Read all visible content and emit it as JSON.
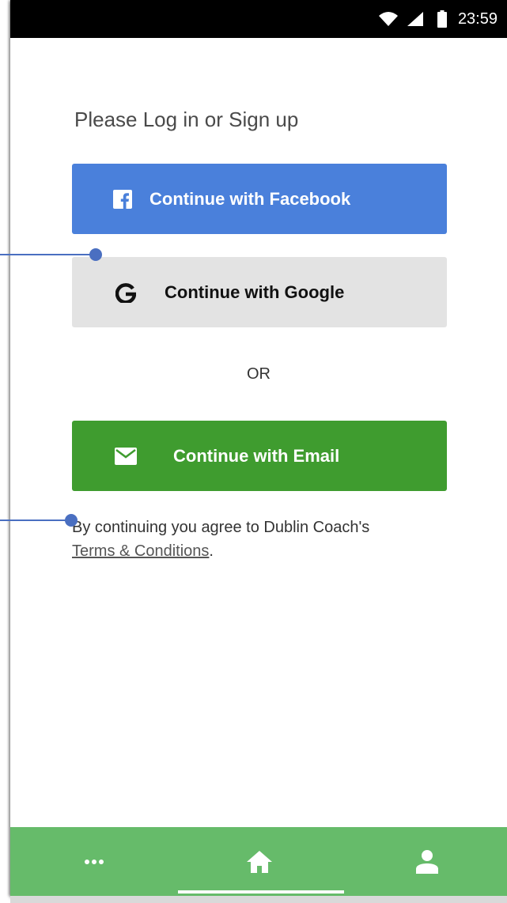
{
  "status_bar": {
    "time": "23:59",
    "icons": [
      "wifi-icon",
      "signal-icon",
      "battery-icon"
    ]
  },
  "login": {
    "title": "Please Log in or Sign up",
    "facebook": {
      "label": "Continue with Facebook",
      "icon": "facebook-icon",
      "color": "#4a80db"
    },
    "google": {
      "label": "Continue with Google",
      "icon": "google-icon",
      "color": "#e3e3e3"
    },
    "separator": "OR",
    "email": {
      "label": "Continue with Email",
      "icon": "mail-icon",
      "color": "#3f9c2f"
    }
  },
  "terms": {
    "prefix": "By continuing you agree to Dublin Coach's",
    "link": "Terms & Conditions",
    "suffix": "."
  },
  "tab_bar": {
    "color": "#66bb6a",
    "items": [
      {
        "name": "more",
        "icon": "more-icon"
      },
      {
        "name": "home",
        "icon": "home-icon"
      },
      {
        "name": "profile",
        "icon": "person-icon"
      }
    ]
  }
}
